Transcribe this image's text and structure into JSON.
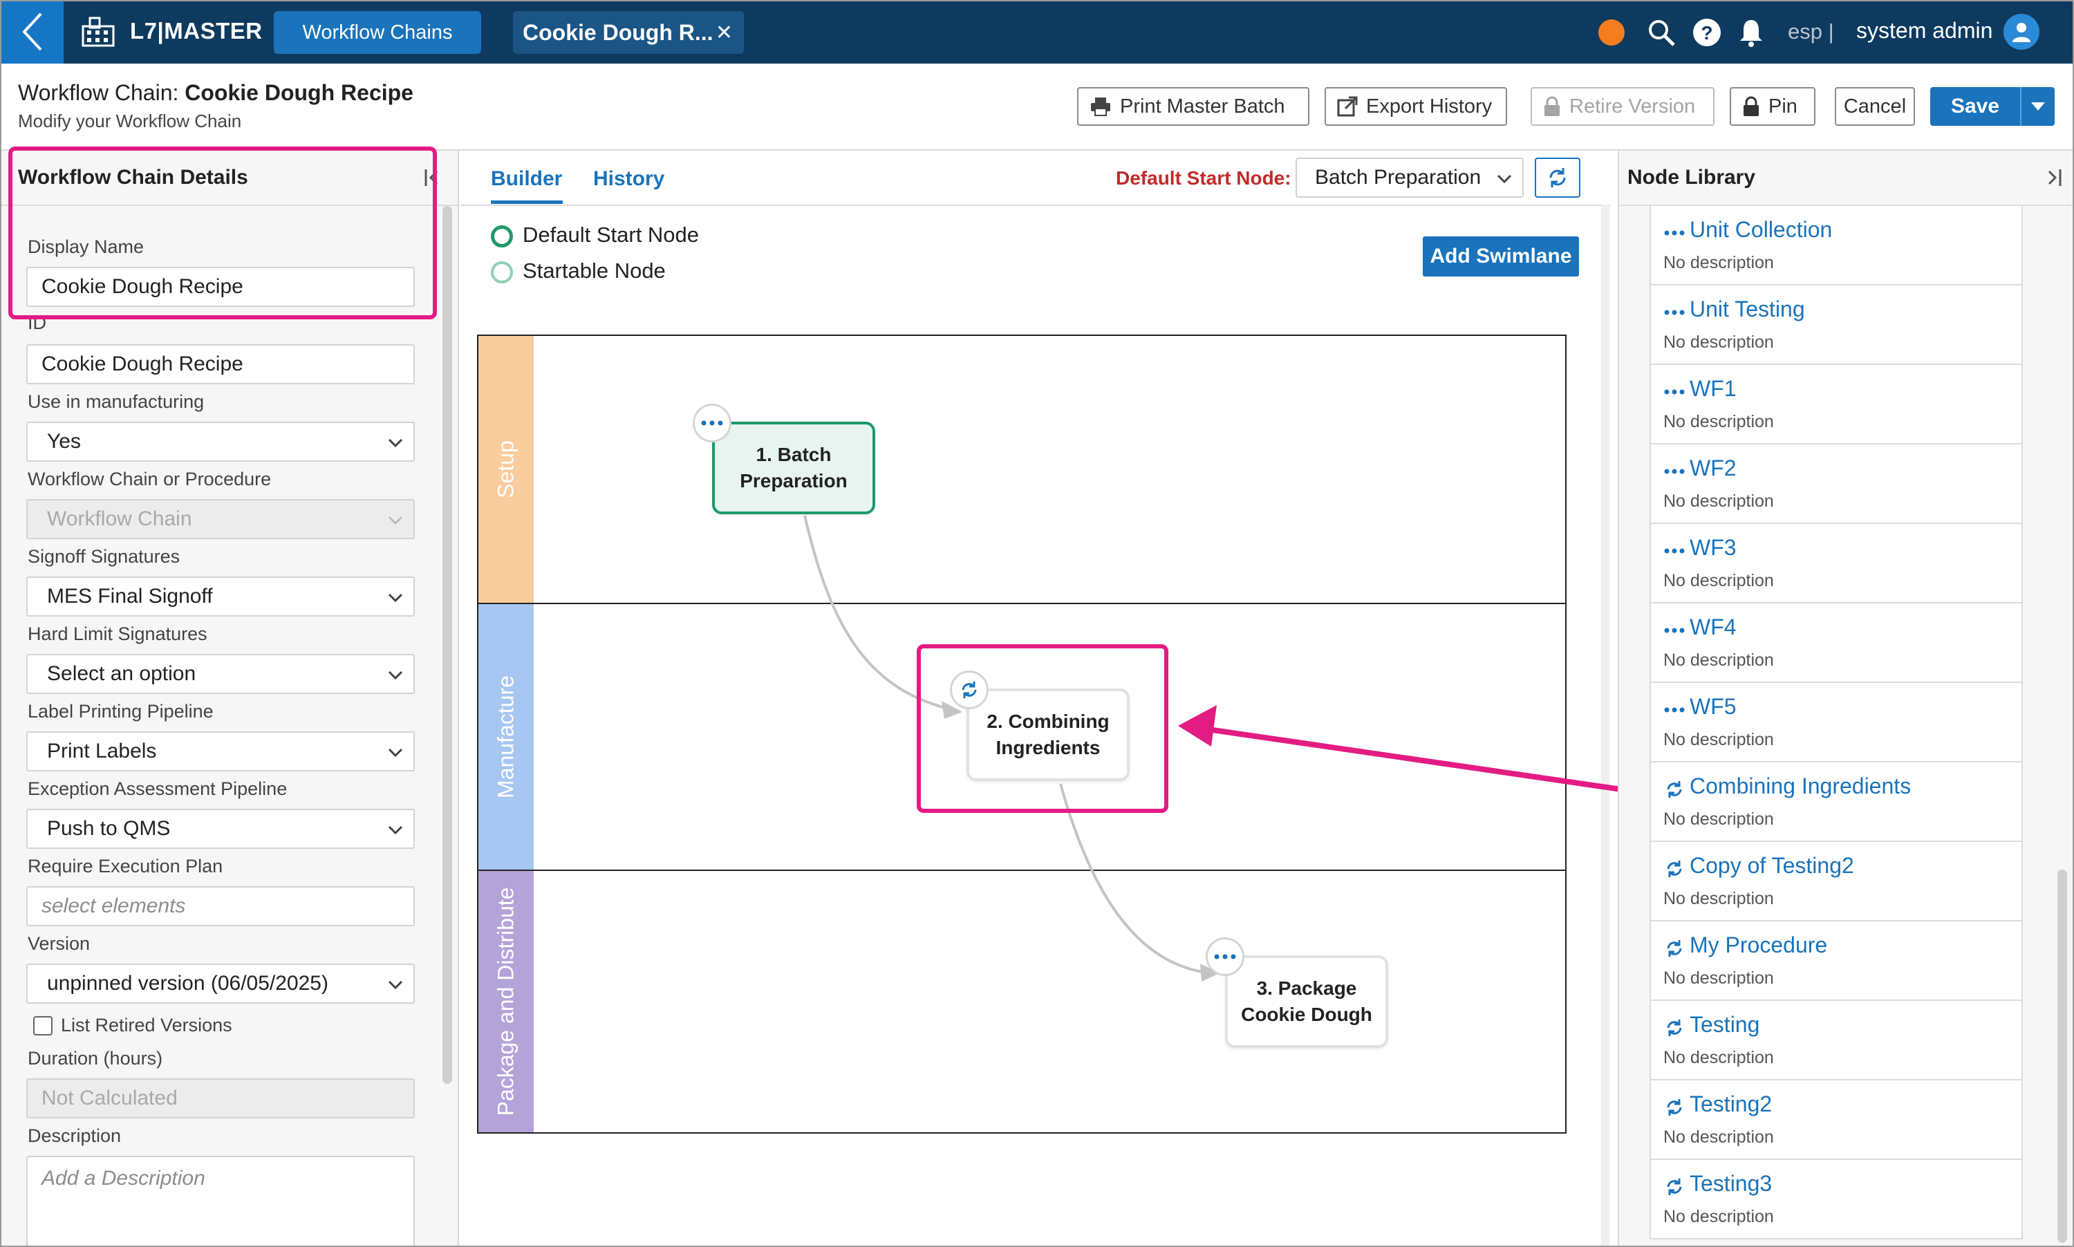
{
  "topbar": {
    "app_name": "L7|MASTER",
    "tabs": [
      {
        "label": "Workflow Chains"
      },
      {
        "label": "Cookie Dough R..."
      }
    ],
    "lang": "esp |",
    "user": "system admin"
  },
  "header": {
    "title_prefix": "Workflow Chain: ",
    "title_name": "Cookie Dough Recipe",
    "subtitle": "Modify your Workflow Chain",
    "buttons": {
      "print": "Print Master Batch",
      "export": "Export History",
      "retire": "Retire Version",
      "pin": "Pin",
      "cancel": "Cancel",
      "save": "Save"
    }
  },
  "details": {
    "title": "Workflow Chain Details",
    "fields": [
      {
        "label": "Display Name",
        "value": "Cookie Dough Recipe"
      },
      {
        "label": "ID",
        "value": "Cookie Dough Recipe"
      },
      {
        "label": "Use in manufacturing",
        "value": "Yes"
      },
      {
        "label": "Workflow Chain or Procedure",
        "value": "Workflow Chain"
      },
      {
        "label": "Signoff Signatures",
        "value": "MES Final Signoff"
      },
      {
        "label": "Hard Limit Signatures",
        "value": "Select an option"
      },
      {
        "label": "Label Printing Pipeline",
        "value": "Print Labels"
      },
      {
        "label": "Exception Assessment Pipeline",
        "value": "Push to QMS"
      },
      {
        "label": "Require Execution Plan",
        "placeholder": "select elements"
      },
      {
        "label": "Version",
        "value": "unpinned version (06/05/2025)"
      },
      {
        "label": "Duration (hours)",
        "value": "Not Calculated"
      },
      {
        "label": "Description",
        "placeholder": "Add a Description"
      }
    ],
    "list_retired": "List Retired Versions"
  },
  "builder": {
    "tabs": [
      "Builder",
      "History"
    ],
    "default_start_label": "Default Start Node:",
    "default_start_value": "Batch Preparation",
    "legend": {
      "default_start": "Default Start Node",
      "startable": "Startable Node"
    },
    "add_swimlane": "Add Swimlane",
    "swimlanes": [
      "Setup",
      "Manufacture",
      "Package and Distribute"
    ],
    "nodes": [
      {
        "label": "1. Batch\nPreparation",
        "type": "start"
      },
      {
        "label": "2. Combining\nIngredients",
        "type": "procedure"
      },
      {
        "label": "3. Package\nCookie Dough",
        "type": "workflow"
      }
    ]
  },
  "library": {
    "title": "Node Library",
    "items": [
      {
        "name": "Unit Collection",
        "desc": "No description",
        "icon": "workflow-dots-icon"
      },
      {
        "name": "Unit Testing",
        "desc": "No description",
        "icon": "workflow-dots-icon"
      },
      {
        "name": "WF1",
        "desc": "No description",
        "icon": "workflow-dots-icon"
      },
      {
        "name": "WF2",
        "desc": "No description",
        "icon": "workflow-dots-icon"
      },
      {
        "name": "WF3",
        "desc": "No description",
        "icon": "workflow-dots-icon"
      },
      {
        "name": "WF4",
        "desc": "No description",
        "icon": "workflow-dots-icon"
      },
      {
        "name": "WF5",
        "desc": "No description",
        "icon": "workflow-dots-icon"
      },
      {
        "name": "Combining Ingredients",
        "desc": "No description",
        "icon": "procedure-cycle-icon"
      },
      {
        "name": "Copy of Testing2",
        "desc": "No description",
        "icon": "procedure-cycle-icon"
      },
      {
        "name": "My Procedure",
        "desc": "No description",
        "icon": "procedure-cycle-icon"
      },
      {
        "name": "Testing",
        "desc": "No description",
        "icon": "procedure-cycle-icon"
      },
      {
        "name": "Testing2",
        "desc": "No description",
        "icon": "procedure-cycle-icon"
      },
      {
        "name": "Testing3",
        "desc": "No description",
        "icon": "procedure-cycle-icon"
      }
    ]
  },
  "colors": {
    "topbar": "#0e3a5f",
    "accent": "#1a73bb",
    "annotation": "#e31c84",
    "lane_setup": "#f8cc9c",
    "lane_manufacture": "#a7c6f1",
    "lane_package": "#b3a3d8",
    "start_node": "#1e9a6a"
  }
}
